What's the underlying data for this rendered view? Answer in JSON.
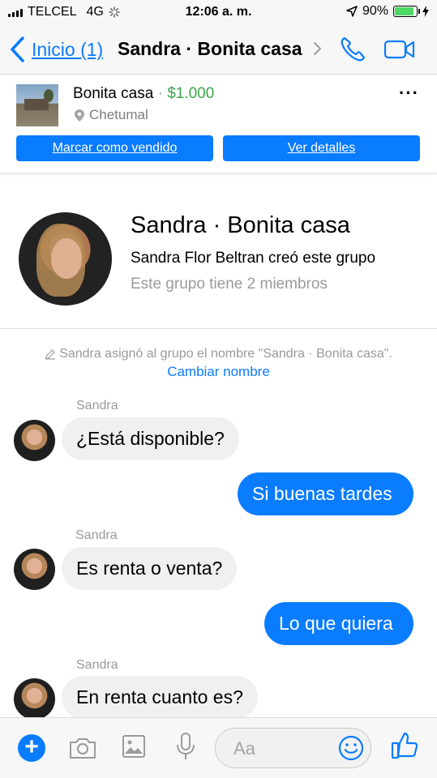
{
  "status_bar": {
    "carrier": "TELCEL",
    "network": "4G",
    "time": "12:06 a. m.",
    "battery": "90%",
    "battery_level": 0.9,
    "battery_color": "#4cd964"
  },
  "nav": {
    "back_label": "Inicio (1)",
    "title": "Sandra · Bonita casa",
    "accent": "#0a7cff"
  },
  "listing": {
    "title": "Bonita casa",
    "separator": "·",
    "price": "$1.000",
    "location": "Chetumal",
    "mark_sold_label": "Marcar como vendido",
    "details_label": "Ver detalles",
    "more_icon": "more-horizontal-icon"
  },
  "group": {
    "name": "Sandra · Bonita casa",
    "created_by": "Sandra Flor Beltran creó este grupo",
    "members": "Este grupo tiene 2 miembros"
  },
  "system_message": {
    "text": "Sandra asignó al grupo el nombre \"Sandra · Bonita casa\".",
    "action": "Cambiar nombre"
  },
  "messages": [
    {
      "sender": "Sandra",
      "text": "¿Está disponible?",
      "direction": "in"
    },
    {
      "text": "Si buenas tardes",
      "direction": "out"
    },
    {
      "sender": "Sandra",
      "text": "Es renta o venta?",
      "direction": "in"
    },
    {
      "text": "Lo que quiera",
      "direction": "out"
    },
    {
      "sender": "Sandra",
      "text": "En renta cuanto es?",
      "direction": "in"
    }
  ],
  "composer": {
    "placeholder": "Aa",
    "icons": [
      "plus-icon",
      "camera-icon",
      "image-icon",
      "microphone-icon",
      "emoji-icon",
      "thumbs-up-icon"
    ]
  }
}
